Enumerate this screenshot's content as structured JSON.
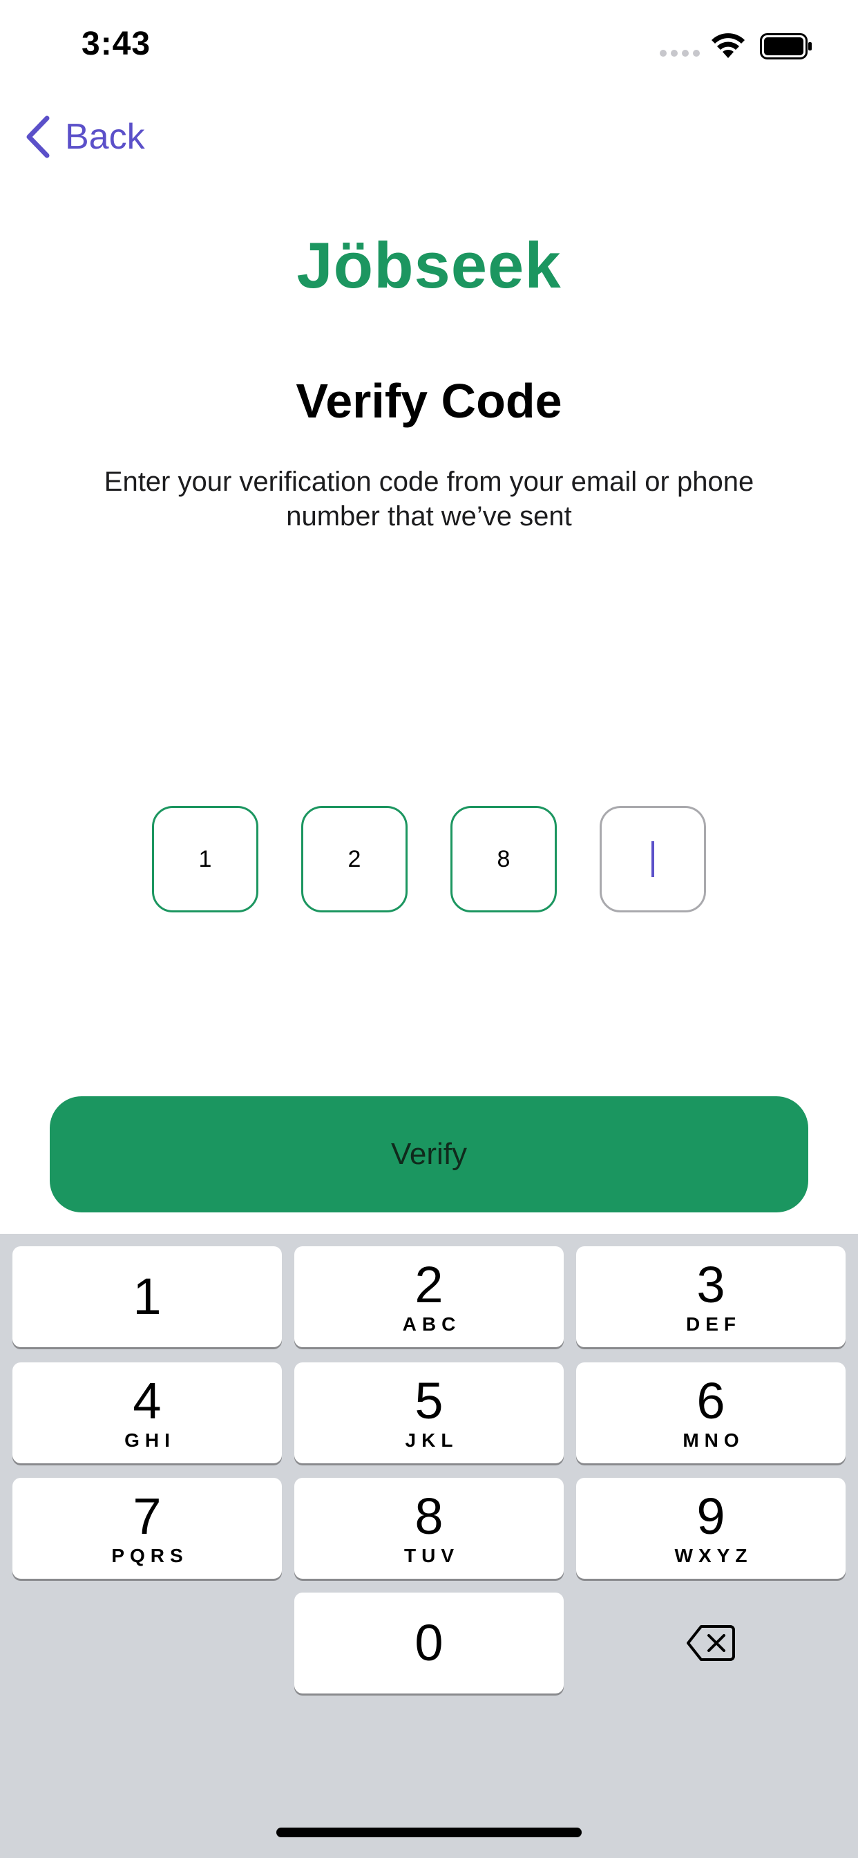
{
  "status_bar": {
    "time": "3:43"
  },
  "nav": {
    "back_label": "Back"
  },
  "brand": {
    "name": "Jöbseek",
    "color": "#1c9660"
  },
  "page": {
    "title": "Verify Code",
    "subtitle": "Enter your verification code from your email or phone number that we’ve sent"
  },
  "otp": {
    "digits": [
      "1",
      "2",
      "8",
      ""
    ]
  },
  "actions": {
    "verify_label": "Verify"
  },
  "keypad": {
    "keys": [
      {
        "num": "1",
        "letters": ""
      },
      {
        "num": "2",
        "letters": "ABC"
      },
      {
        "num": "3",
        "letters": "DEF"
      },
      {
        "num": "4",
        "letters": "GHI"
      },
      {
        "num": "5",
        "letters": "JKL"
      },
      {
        "num": "6",
        "letters": "MNO"
      },
      {
        "num": "7",
        "letters": "PQRS"
      },
      {
        "num": "8",
        "letters": "TUV"
      },
      {
        "num": "9",
        "letters": "WXYZ"
      },
      {
        "num": "0",
        "letters": ""
      }
    ],
    "delete_icon": "backspace-icon"
  },
  "colors": {
    "accent": "#5b50c9",
    "primary": "#1b9660",
    "keyboard_bg": "#d1d4d9"
  }
}
